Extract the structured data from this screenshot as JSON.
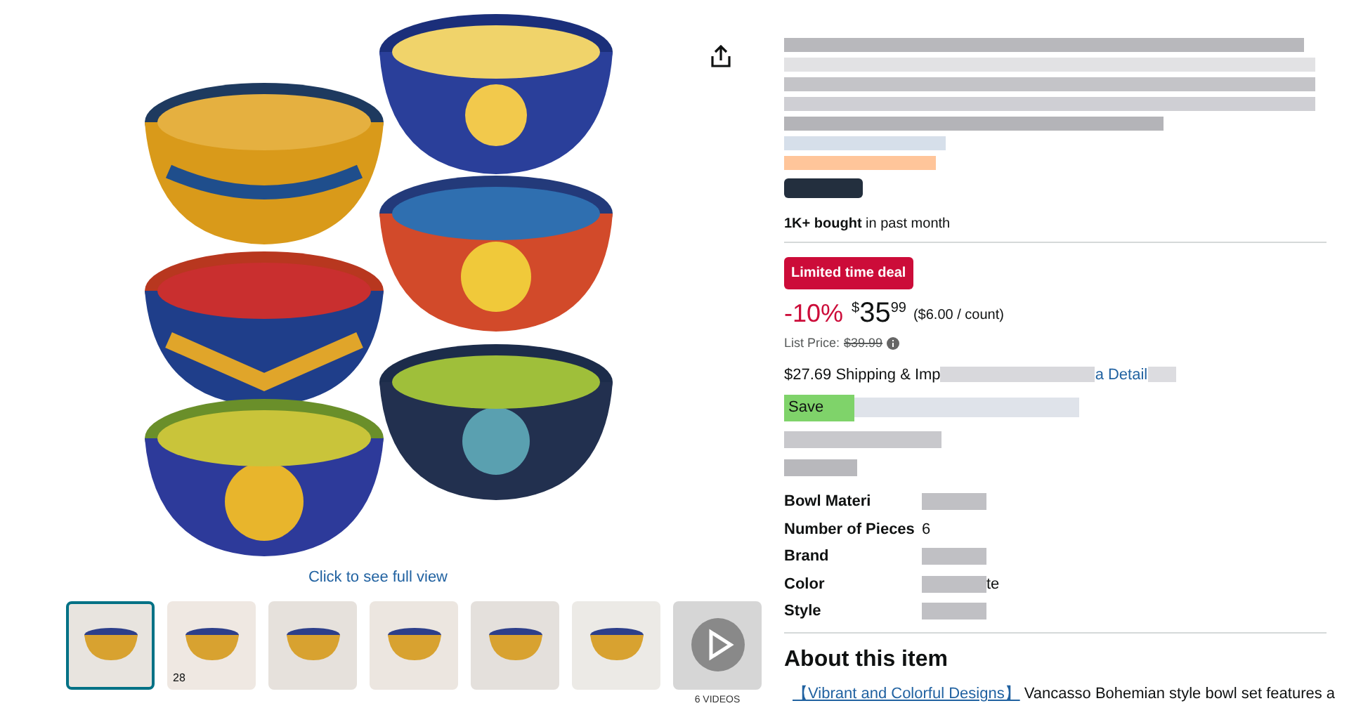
{
  "gallery": {
    "caption": "Click to see full view",
    "thumbnails": [
      {
        "kind": "photo",
        "selected": true
      },
      {
        "kind": "photo",
        "selected": false,
        "label": "28"
      },
      {
        "kind": "photo",
        "selected": false
      },
      {
        "kind": "photo",
        "selected": false
      },
      {
        "kind": "photo",
        "selected": false
      },
      {
        "kind": "photo",
        "selected": false
      },
      {
        "kind": "video",
        "selected": false,
        "label": "6 VIDEOS"
      }
    ]
  },
  "product": {
    "social_proof": {
      "bold": "1K+ bought",
      "rest": "in past month"
    },
    "deal_badge": "Limited time deal",
    "discount": "-10%",
    "price": {
      "symbol": "$",
      "whole": "35",
      "fraction": "99",
      "unit": "($6.00 / count)"
    },
    "list_price": {
      "label": "List Price:",
      "value": "$39.99"
    },
    "shipping": {
      "text": "$27.69 Shipping & Imp",
      "link": "a Detail"
    },
    "save": "Save",
    "specs": [
      {
        "label": "Bowl Materi",
        "kind": "redacted"
      },
      {
        "label": "Number of Pieces",
        "value": "6",
        "kind": "plain"
      },
      {
        "label": "Brand",
        "kind": "redacted"
      },
      {
        "label": "Color",
        "value": "te",
        "kind": "partial"
      },
      {
        "label": "Style",
        "kind": "redacted"
      }
    ],
    "about": {
      "heading": "About this item",
      "bullets": [
        {
          "tag": "【Vibrant and Colorful Designs】",
          "text": "Vancasso Bohemian style bowl set features a"
        }
      ]
    }
  }
}
